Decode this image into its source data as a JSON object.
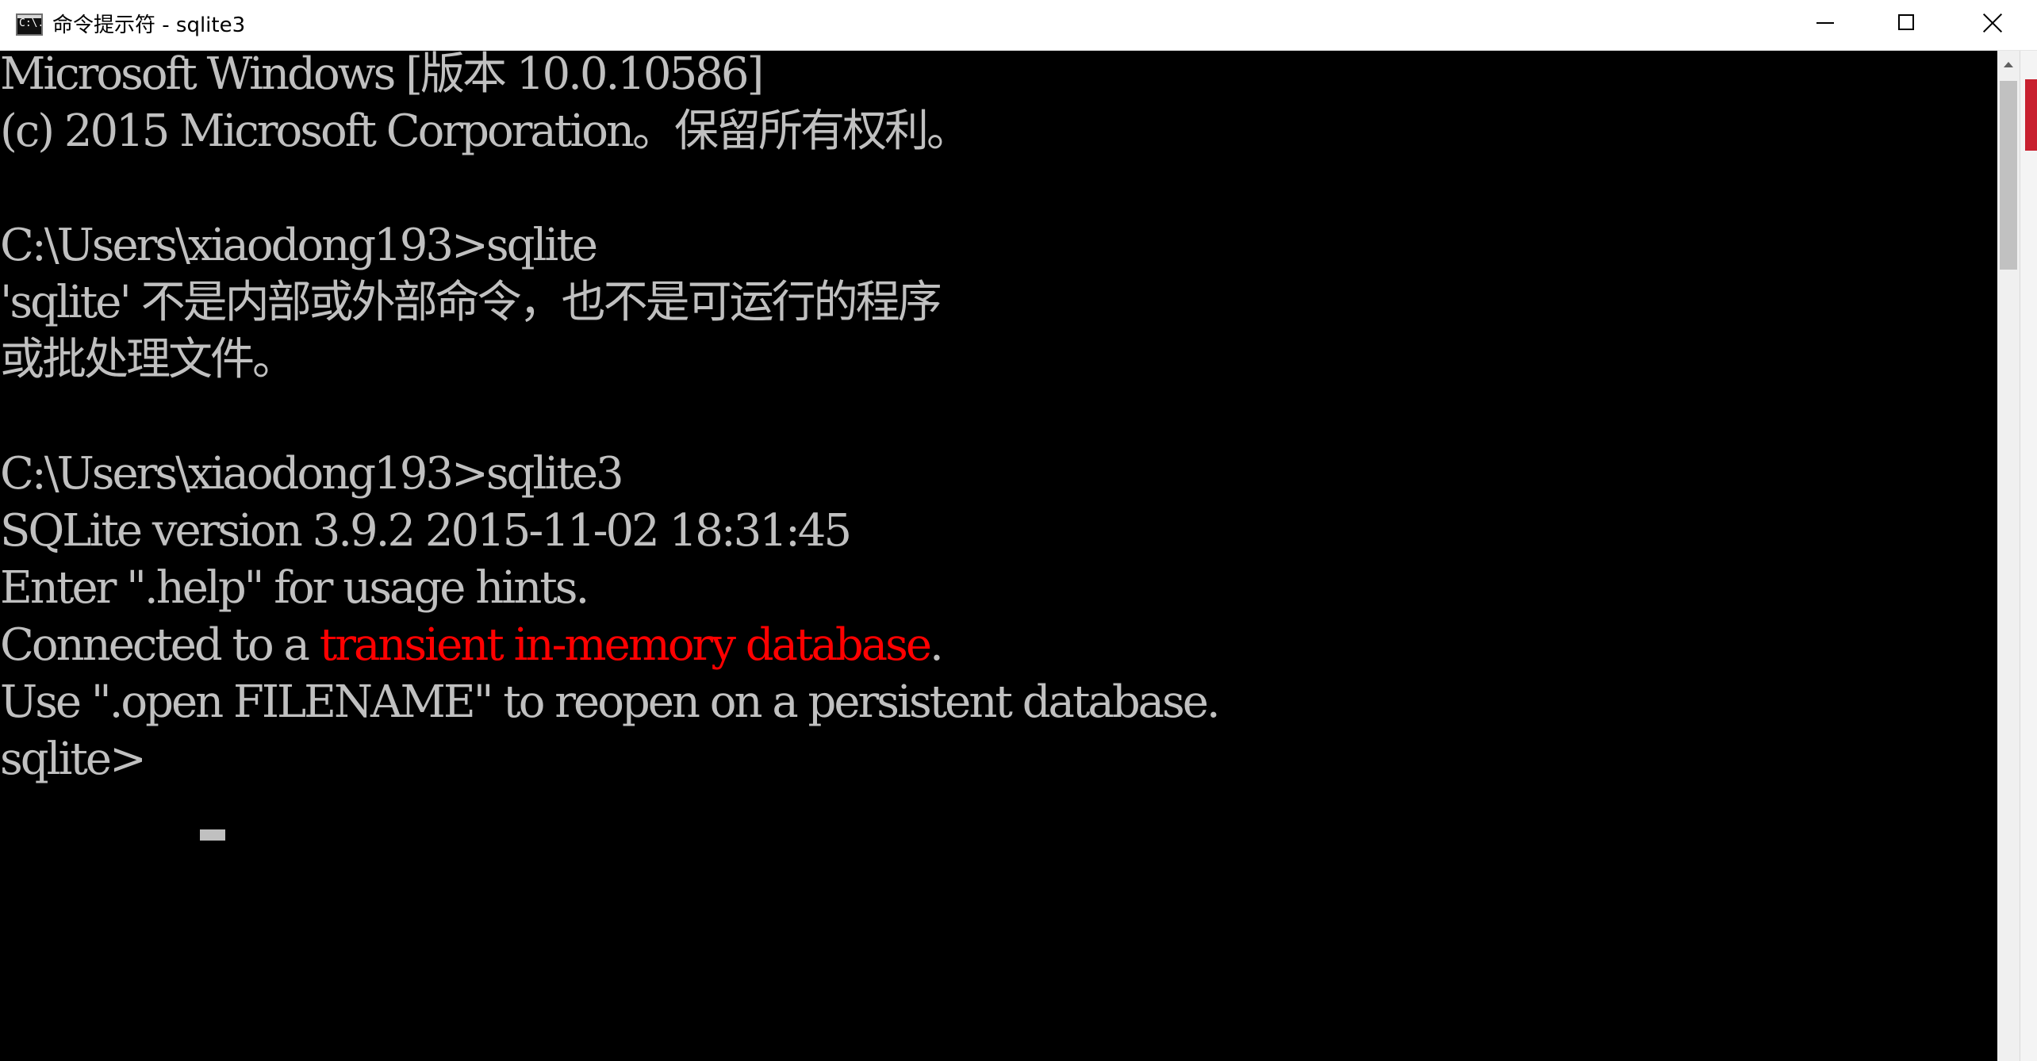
{
  "window": {
    "title": "命令提示符 - sqlite3",
    "icon_text": "C:\\."
  },
  "titlebar_buttons": {
    "minimize": "minimize",
    "maximize": "maximize",
    "close": "close"
  },
  "console": {
    "lines": [
      "Microsoft Windows [版本 10.0.10586]",
      "(c) 2015 Microsoft Corporation。保留所有权利。",
      "",
      "C:\\Users\\xiaodong193>sqlite",
      "'sqlite' 不是内部或外部命令，也不是可运行的程序",
      "或批处理文件。",
      "",
      "C:\\Users\\xiaodong193>sqlite3",
      "SQLite version 3.9.2 2015-11-02 18:31:45",
      "Enter \".help\" for usage hints."
    ],
    "connected_prefix": "Connected to a ",
    "connected_highlight": "transient in-memory database",
    "connected_suffix": ".",
    "open_hint": "Use \".open FILENAME\" to reopen on a persistent database.",
    "prompt": "sqlite> "
  },
  "colors": {
    "console_background": "#000000",
    "console_text": "#c0c0c0",
    "highlight": "#ff0000",
    "titlebar": "#ffffff"
  }
}
